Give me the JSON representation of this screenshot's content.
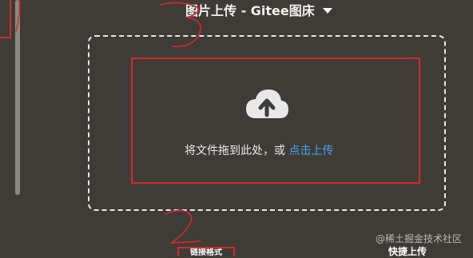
{
  "header": {
    "title": "图片上传 - Gitee图床"
  },
  "drop_zone": {
    "prompt_text": "将文件拖到此处，或",
    "click_upload_link": "点击上传"
  },
  "footer": {
    "left_label": "链接格式",
    "right_label": "快捷上传"
  },
  "watermark": "@稀土掘金技术社区",
  "icons": {
    "upload": "cloud-upload-icon",
    "dropdown": "caret-down-icon"
  },
  "colors": {
    "background": "#3f3c38",
    "link": "#4fa3e8",
    "annotation_red": "#d42a2a"
  }
}
